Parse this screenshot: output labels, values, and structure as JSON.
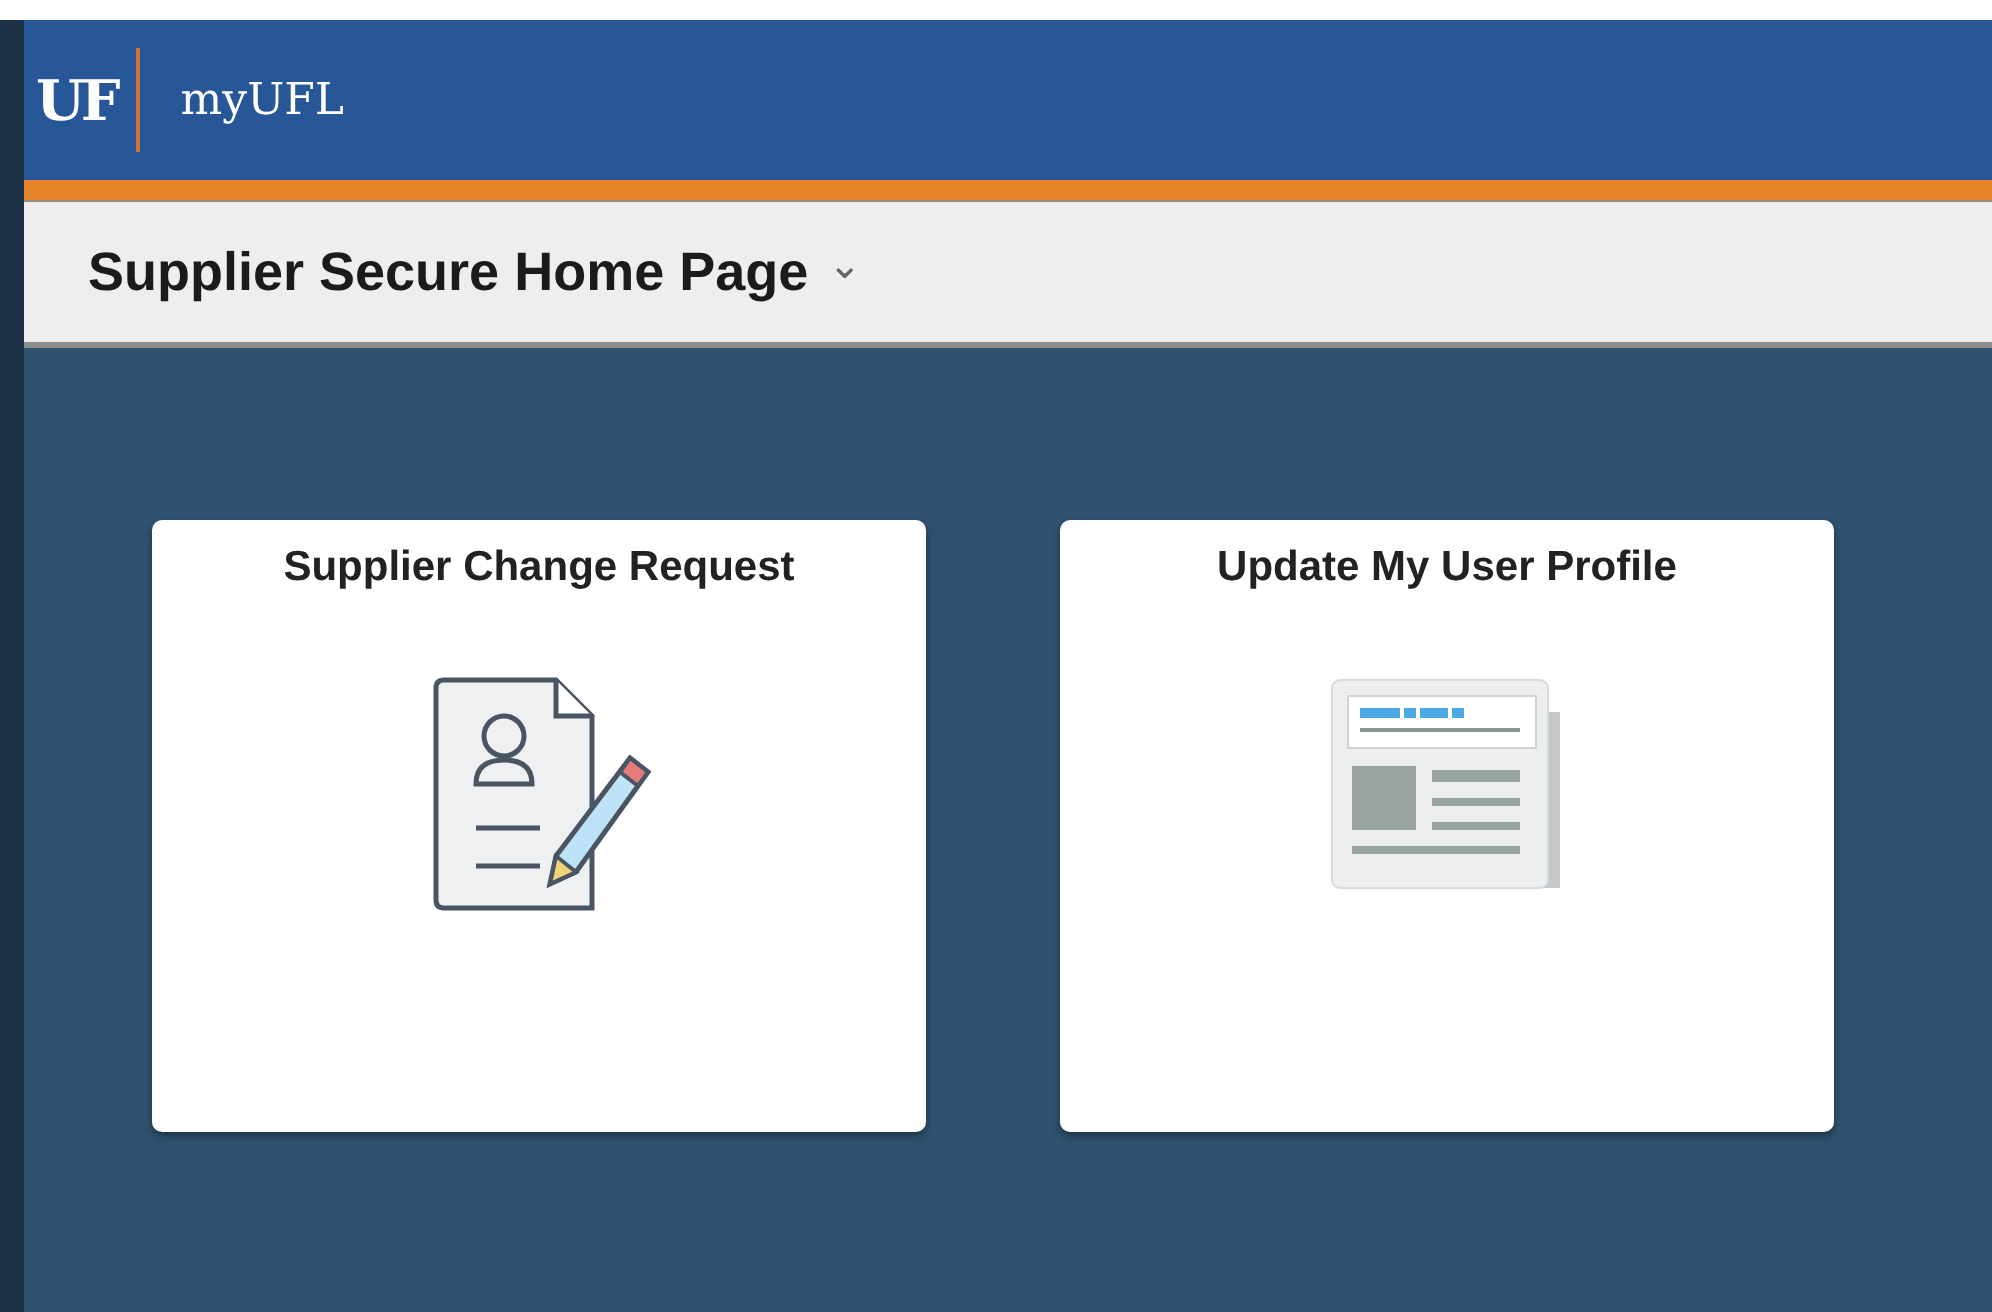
{
  "header": {
    "logo": "UF",
    "app_name": "myUFL"
  },
  "page_title": {
    "text": "Supplier Secure Home Page",
    "caret": "⌄"
  },
  "tiles": [
    {
      "title": "Supplier Change Request",
      "kind": "document-edit"
    },
    {
      "title": "Update My User Profile",
      "kind": "newspaper"
    }
  ]
}
